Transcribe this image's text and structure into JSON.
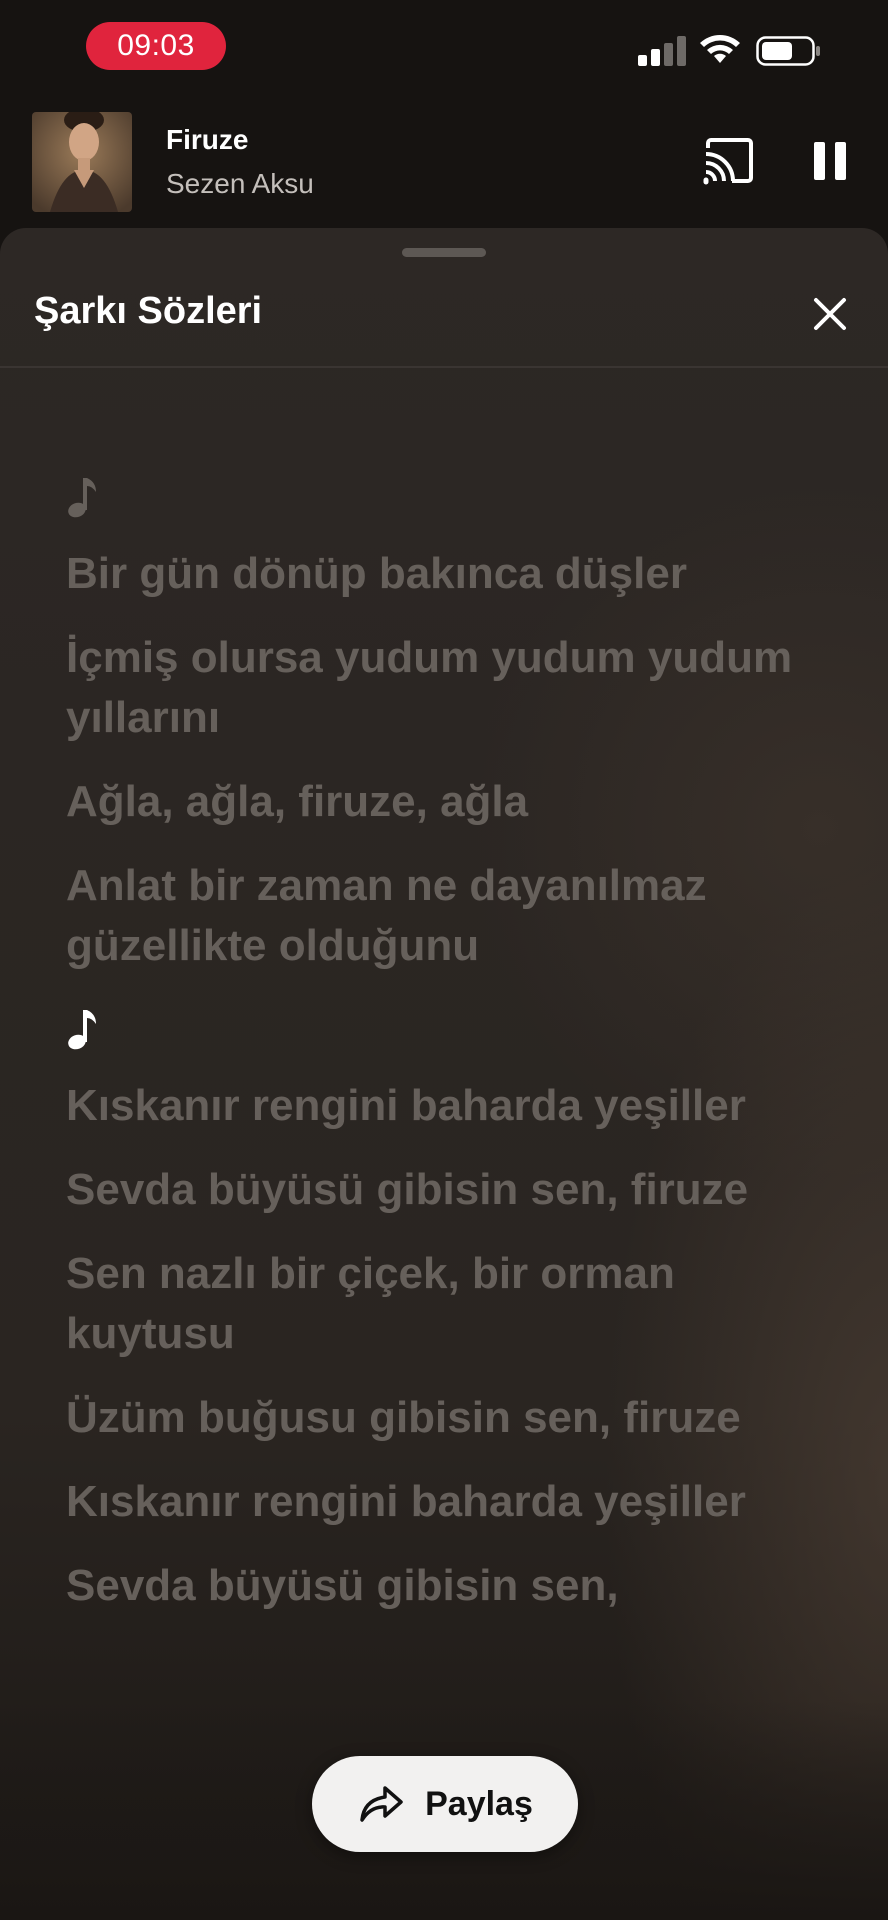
{
  "status_bar": {
    "time": "09:03"
  },
  "mini_player": {
    "title": "Firuze",
    "artist": "Sezen Aksu",
    "icons": [
      "cast-icon",
      "pause-icon"
    ]
  },
  "lyrics_sheet": {
    "title": "Şarkı Sözleri",
    "close_icon": "close-icon",
    "note_symbol": "♪",
    "lines": [
      "Bir gün dönüp bakınca düşler",
      "İçmiş olursa yudum yudum yudum yıllarını",
      "Ağla, ağla, firuze, ağla",
      "Anlat bir zaman ne dayanılmaz güzellikte olduğunu",
      "Kıskanır rengini baharda yeşiller",
      "Sevda büyüsü gibisin sen, firuze",
      "Sen nazlı bir çiçek, bir orman kuytusu",
      "Üzüm buğusu gibisin sen, firuze",
      "Kıskanır rengini baharda yeşiller",
      "Sevda büyüsü gibisin sen,"
    ]
  },
  "share_button": {
    "label": "Paylaş",
    "icon": "share-icon"
  },
  "colors": {
    "time_pill": "#e0243d",
    "lyric_dim": "#66605b",
    "lyric_active": "#ffffff",
    "share_bg": "#f2f1f0"
  }
}
